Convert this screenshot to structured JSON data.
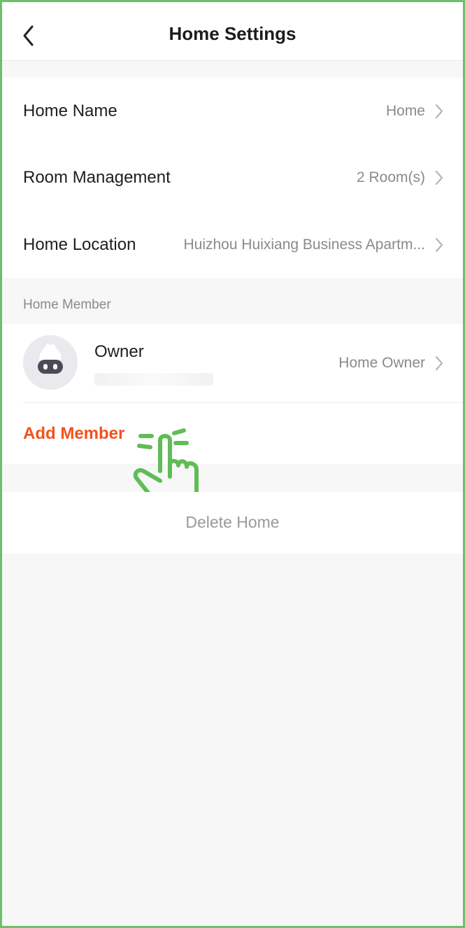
{
  "header": {
    "title": "Home Settings",
    "back_icon": "chevron-left-icon"
  },
  "settings": [
    {
      "label": "Home Name",
      "value": "Home"
    },
    {
      "label": "Room Management",
      "value": "2 Room(s)"
    },
    {
      "label": "Home Location",
      "value": "Huizhou Huixiang Business Apartm..."
    }
  ],
  "members": {
    "section_label": "Home Member",
    "owner": {
      "name": "Owner",
      "role": "Home Owner",
      "avatar_icon": "robot-avatar-icon"
    },
    "add_label": "Add Member"
  },
  "actions": {
    "delete_label": "Delete Home"
  },
  "overlay": {
    "tap_icon": "hand-tap-icon"
  },
  "colors": {
    "accent": "#f4511e",
    "frame_border": "#6cc06a",
    "background": "#f7f7f7"
  }
}
